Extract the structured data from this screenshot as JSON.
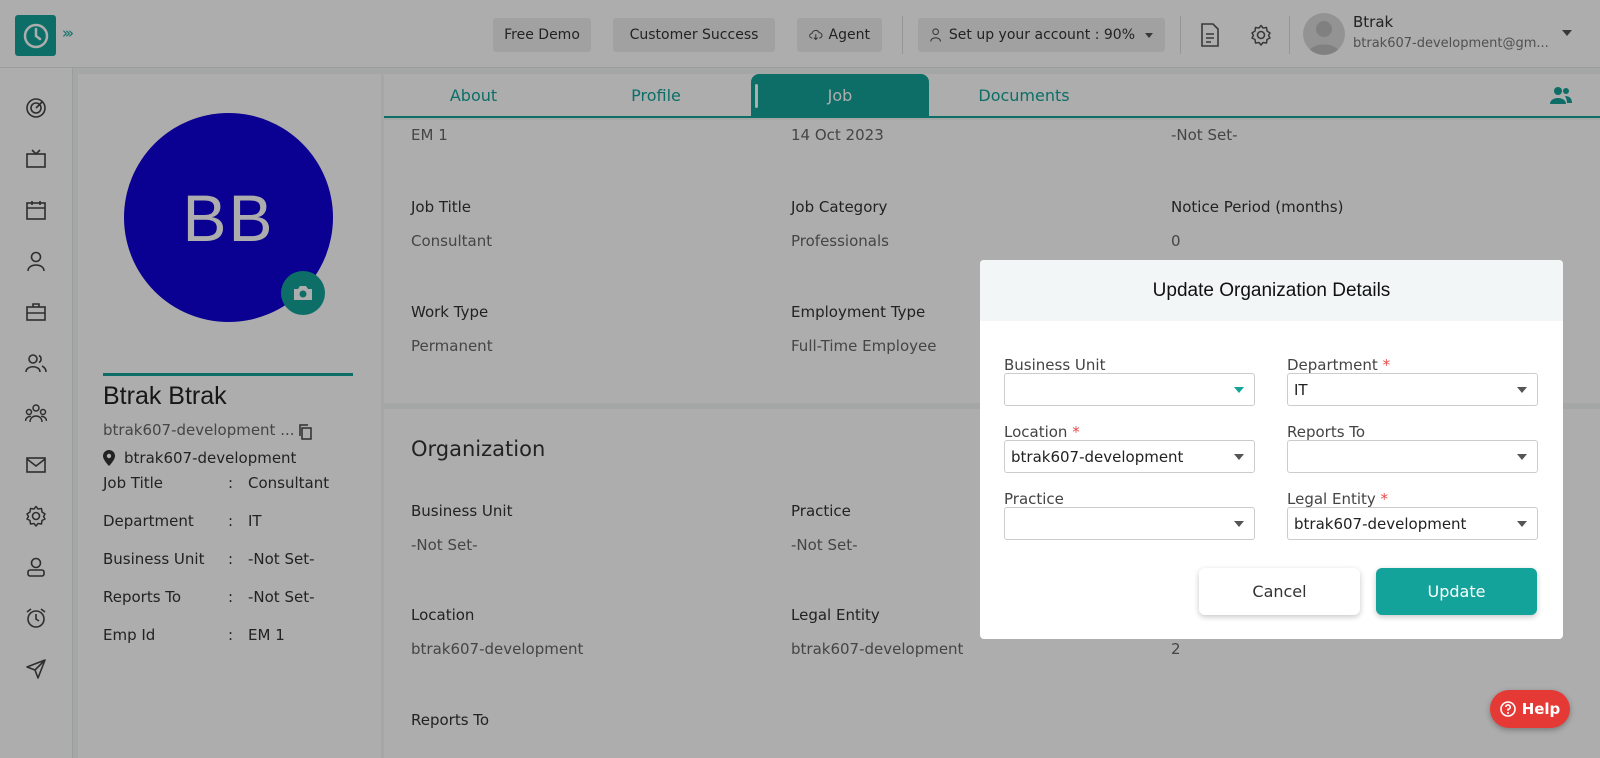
{
  "header": {
    "free_demo": "Free Demo",
    "customer_success": "Customer Success",
    "agent": "Agent",
    "setup": "Set up your account : 90%",
    "user_name": "Btrak",
    "user_email": "btrak607-development@gm..."
  },
  "tabs": [
    "About",
    "Profile",
    "Job",
    "Documents"
  ],
  "profile": {
    "initials": "BB",
    "name": "Btrak Btrak",
    "email": "btrak607-development ...",
    "location": "btrak607-development",
    "rows": [
      {
        "key": "Job Title",
        "colon": ":",
        "value": "Consultant"
      },
      {
        "key": "Department",
        "colon": ":",
        "value": "IT"
      },
      {
        "key": "Business Unit",
        "colon": ":",
        "value": "-Not Set-"
      },
      {
        "key": "Reports To",
        "colon": ":",
        "value": "-Not Set-"
      },
      {
        "key": "Emp Id",
        "colon": ":",
        "value": "EM 1"
      }
    ]
  },
  "job": {
    "row0": [
      "EM 1",
      "14 Oct 2023",
      "-Not Set-"
    ],
    "labels1": [
      "Job Title",
      "Job Category",
      "Notice Period (months)"
    ],
    "values1": [
      "Consultant",
      "Professionals",
      "0"
    ],
    "labels2": [
      "Work Type",
      "Employment Type"
    ],
    "values2": [
      "Permanent",
      "Full-Time Employee"
    ]
  },
  "organization": {
    "title": "Organization",
    "labels1": [
      "Business Unit",
      "Practice"
    ],
    "values1": [
      "-Not Set-",
      "-Not Set-"
    ],
    "labels2": [
      "Location",
      "Legal Entity"
    ],
    "values2": [
      "btrak607-development",
      "btrak607-development",
      "2"
    ],
    "reports_to": "Reports To"
  },
  "modal": {
    "title": "Update Organization Details",
    "business_unit_label": "Business Unit",
    "business_unit_value": "",
    "department_label": "Department",
    "department_value": "IT",
    "location_label": "Location",
    "location_value": "btrak607-development",
    "reports_to_label": "Reports To",
    "reports_to_value": "",
    "practice_label": "Practice",
    "practice_value": "",
    "legal_entity_label": "Legal Entity",
    "legal_entity_value": "btrak607-development",
    "required_mark": "*",
    "cancel": "Cancel",
    "update": "Update"
  },
  "help": "Help",
  "colors": {
    "accent": "#14a39a",
    "avatar": "#0f00d6",
    "help": "#e53935"
  }
}
